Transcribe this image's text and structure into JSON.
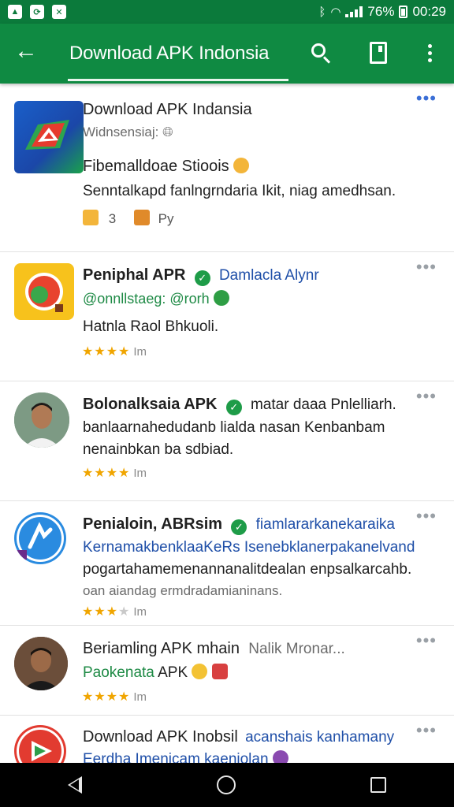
{
  "status_bar": {
    "battery": "76%",
    "time": "00:29"
  },
  "app_bar": {
    "title": "Download APK Indonsia"
  },
  "posts": [
    {
      "title": "Download APK Indansia",
      "subtitle": "Widnsensiaj:",
      "headline": "Fibemalldoae Stioois",
      "body": "Senntalkapd fanlngrndaria Ikit, niag amedhsan.",
      "reaction_count": "3",
      "reaction_label": "Py"
    },
    {
      "name": "Peniphal APR",
      "handle_link": "Damlacla Alynr",
      "handle": "@onnllstaeg: @rorh",
      "body": "Hatnla Raol Bhkuoli.",
      "rating_label": "Im",
      "rating": 4
    },
    {
      "name": "Bolonalksaia APK",
      "caption": "matar daaa Pnlelliarh.",
      "body_line1": "banlaarnahedudanb lialda nasan Kenbanbam",
      "body_line2": "nenainbkan ba sdbiad.",
      "rating_label": "Im",
      "rating": 4
    },
    {
      "name": "Penialoin, ABRsim",
      "caption": "fiamlararkanekaraika",
      "body_line1": "KernamakbenklaaKeRs Isenebklanerpakanelvand",
      "body_line2": "pogartahamemenannanalitdealan enpsalkarcahb.",
      "body_line3": "oan aiandag ermdradamianinans.",
      "rating_label": "Im",
      "rating": 3.5
    },
    {
      "name": "Beriamling APK mhain",
      "caption": "Nalik Mronar...",
      "subline_green": "Paokenata",
      "subline_rest": "APK",
      "rating_label": "Im",
      "rating": 4
    },
    {
      "name": "Download APK Inobsil",
      "caption": "acanshais kanhamany",
      "subline": "Eerdha Imenicam kaeniolan"
    }
  ],
  "icons": {
    "back": "arrow-left-icon",
    "search": "search-icon",
    "bookmark": "bookmark-icon",
    "overflow": "more-vert-icon"
  },
  "colors": {
    "app_bar": "#0f8a42",
    "status_bar": "#0b7a3b",
    "verified": "#1e9c48",
    "link_blue": "#1f4fa8",
    "star": "#f0a500"
  }
}
